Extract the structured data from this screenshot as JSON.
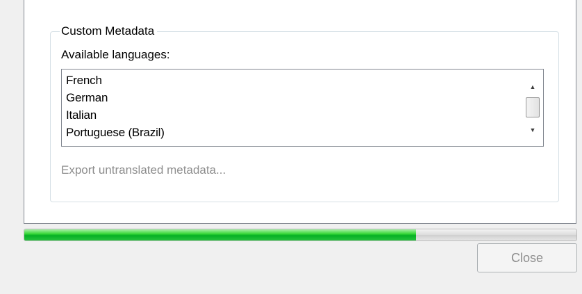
{
  "group": {
    "legend": "Custom Metadata",
    "available_label": "Available languages:",
    "languages": [
      "French",
      "German",
      "Italian",
      "Portuguese (Brazil)"
    ],
    "export_link": "Export untranslated metadata..."
  },
  "scrollbar": {
    "up_icon": "▲",
    "down_icon": "▼"
  },
  "progress": {
    "value_percent": 71,
    "color": "#06b025"
  },
  "footer": {
    "close_label": "Close"
  }
}
